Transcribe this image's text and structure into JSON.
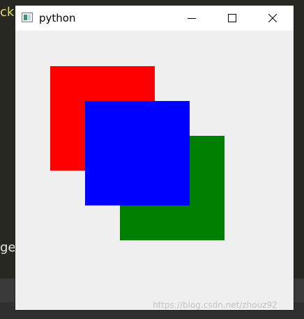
{
  "background": {
    "fragment_top": "ck",
    "fragment_mid": "ge"
  },
  "window": {
    "title": "python",
    "icon": "python-window-icon",
    "controls": {
      "minimize": "minimize-icon",
      "maximize": "maximize-icon",
      "close": "close-icon"
    }
  },
  "canvas": {
    "background": "#efefef",
    "squares": [
      {
        "name": "red-square",
        "color": "#ff0000"
      },
      {
        "name": "green-square",
        "color": "#008000"
      },
      {
        "name": "blue-square",
        "color": "#0000ff"
      }
    ]
  },
  "watermark": "https://blog.csdn.net/zhouz92"
}
